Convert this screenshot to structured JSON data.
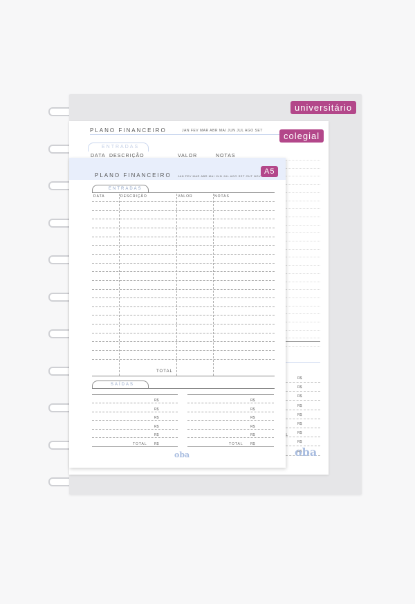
{
  "tags": {
    "universitario": "universitário",
    "colegial": "colegial",
    "a5": "A5"
  },
  "colegial": {
    "title": "PLANO FINANCEIRO",
    "months": "JAN FEV MAR ABR MAI JUN JUL AGO SET",
    "section": "ENTRADAS",
    "headers": [
      "DATA",
      "DESCRIÇÃO",
      "VALOR",
      "NOTAS"
    ],
    "currency": "R$",
    "total_partial": "AL",
    "logo": "oba"
  },
  "a5": {
    "title": "PLANO FINANCEIRO",
    "months": "JAN FEV MAR ABR MAI JUN JUL AGO SET OUT NOV",
    "entradas": "ENTRADAS",
    "headers": [
      "DATA",
      "DESCRIÇÃO",
      "VALOR",
      "NOTAS"
    ],
    "total": "TOTAL",
    "saidas": "SAÍDAS",
    "currency": "R$",
    "logo": "oba"
  },
  "colors": {
    "tag": "#b3478a",
    "header_band": "#e8eefb",
    "logo": "#a9bde0"
  }
}
